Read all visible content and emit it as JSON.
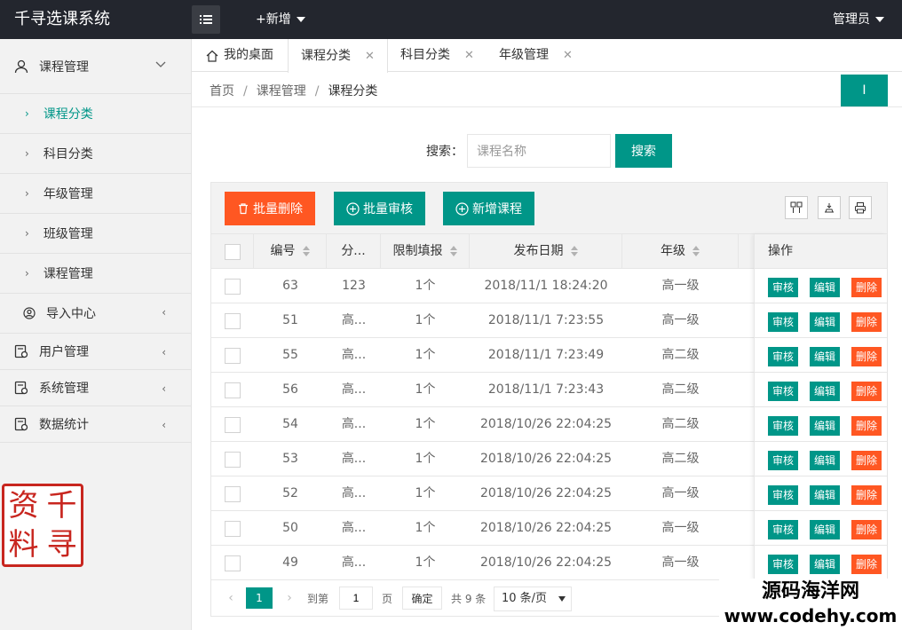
{
  "app": {
    "title": "千寻选课系统",
    "add_label": "+新增",
    "user_label": "管理员"
  },
  "sidebar": {
    "course_mgmt": "课程管理",
    "children": [
      {
        "label": "课程分类",
        "active": true
      },
      {
        "label": "科目分类"
      },
      {
        "label": "年级管理"
      },
      {
        "label": "班级管理"
      },
      {
        "label": "课程管理"
      }
    ],
    "import_center": "导入中心",
    "user_mgmt": "用户管理",
    "system_mgmt": "系统管理",
    "data_stats": "数据统计"
  },
  "seal": {
    "chars": [
      "资",
      "千",
      "料",
      "寻"
    ]
  },
  "tabs": [
    {
      "label": "我的桌面"
    },
    {
      "label": "课程分类",
      "active": true
    },
    {
      "label": "科目分类"
    },
    {
      "label": "年级管理"
    }
  ],
  "breadcrumb": {
    "home": "首页",
    "level1": "课程管理",
    "current": "课程分类",
    "sep": "/"
  },
  "refresh_label": "I",
  "search": {
    "label": "搜索：",
    "placeholder": "课程名称",
    "button": "搜索"
  },
  "toolbar": {
    "batch_delete": "批量删除",
    "batch_audit": "批量审核",
    "add_course": "新增课程"
  },
  "table": {
    "headers": {
      "id": "编号",
      "category": "分...",
      "limit": "限制填报",
      "date": "发布日期",
      "grade": "年级",
      "ops": "操作"
    },
    "rows": [
      {
        "id": "63",
        "category": "123",
        "limit": "1个",
        "date": "2018/11/1 18:24:20",
        "grade": "高一级"
      },
      {
        "id": "51",
        "category": "高...",
        "limit": "1个",
        "date": "2018/11/1 7:23:55",
        "grade": "高一级"
      },
      {
        "id": "55",
        "category": "高...",
        "limit": "1个",
        "date": "2018/11/1 7:23:49",
        "grade": "高二级"
      },
      {
        "id": "56",
        "category": "高...",
        "limit": "1个",
        "date": "2018/11/1 7:23:43",
        "grade": "高二级"
      },
      {
        "id": "54",
        "category": "高...",
        "limit": "1个",
        "date": "2018/10/26 22:04:25",
        "grade": "高二级"
      },
      {
        "id": "53",
        "category": "高...",
        "limit": "1个",
        "date": "2018/10/26 22:04:25",
        "grade": "高二级"
      },
      {
        "id": "52",
        "category": "高...",
        "limit": "1个",
        "date": "2018/10/26 22:04:25",
        "grade": "高一级"
      },
      {
        "id": "50",
        "category": "高...",
        "limit": "1个",
        "date": "2018/10/26 22:04:25",
        "grade": "高一级"
      },
      {
        "id": "49",
        "category": "高...",
        "limit": "1个",
        "date": "2018/10/26 22:04:25",
        "grade": "高一级"
      }
    ],
    "op_labels": {
      "audit": "审核",
      "edit": "编辑",
      "delete": "删除"
    }
  },
  "pager": {
    "current": "1",
    "goto": "到第",
    "page_value": "1",
    "page_unit": "页",
    "confirm": "确定",
    "total": "共 9 条",
    "size": "10 条/页"
  },
  "watermark": {
    "line1": "源码海洋网",
    "line2": "www.codehy.com"
  },
  "colors": {
    "primary": "#009688",
    "danger": "#ff5722",
    "topbar": "#23262e"
  }
}
